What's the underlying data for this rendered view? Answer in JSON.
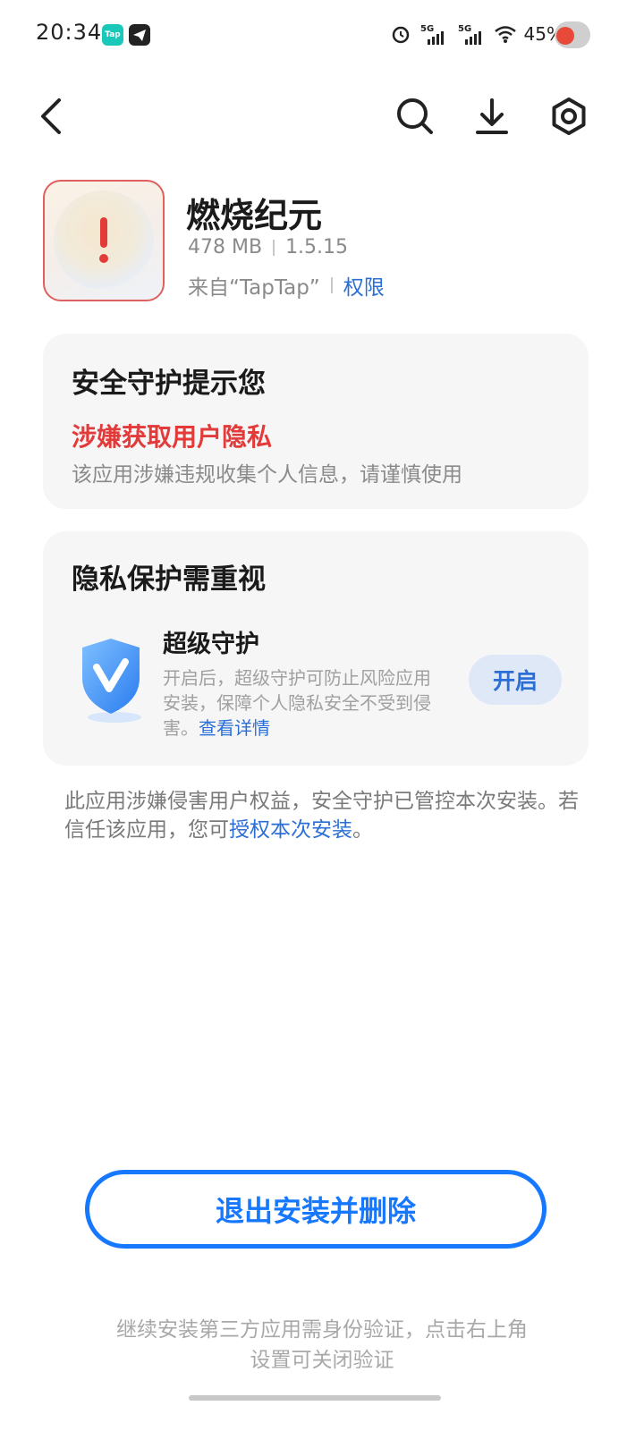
{
  "status_bar": {
    "time": "20:34",
    "tap_label": "Tap",
    "battery": "45%",
    "signal_labels": [
      "5G",
      "5G"
    ]
  },
  "toolbar": {
    "back_icon": "chevron-left-icon",
    "search_icon": "search-icon",
    "download_icon": "download-icon",
    "settings_icon": "settings-icon"
  },
  "app": {
    "name": "燃烧纪元",
    "size": "478 MB",
    "version": "1.5.15",
    "source": "来自“TapTap”",
    "permissions_link": "权限"
  },
  "security_card": {
    "title": "安全守护提示您",
    "warning": "涉嫌获取用户隐私",
    "description": "该应用涉嫌违规收集个人信息，请谨慎使用"
  },
  "privacy_card": {
    "title": "隐私保护需重视",
    "feature_title": "超级守护",
    "feature_desc": "开启后，超级守护可防止风险应用安装，保障个人隐私安全不受到侵害。",
    "details_link": "查看详情",
    "open_button": "开启"
  },
  "notice": {
    "text": "此应用涉嫌侵害用户权益，安全守护已管控本次安装。若信任该应用，您可",
    "link": "授权本次安装",
    "suffix": "。"
  },
  "exit_button": "退出安装并删除",
  "footer": "继续安装第三方应用需身份验证，点击右上角设置可关闭验证",
  "colors": {
    "accent": "#1677ff",
    "link": "#2b6fd6",
    "danger": "#e33a3a",
    "card_bg": "#f6f6f7"
  }
}
